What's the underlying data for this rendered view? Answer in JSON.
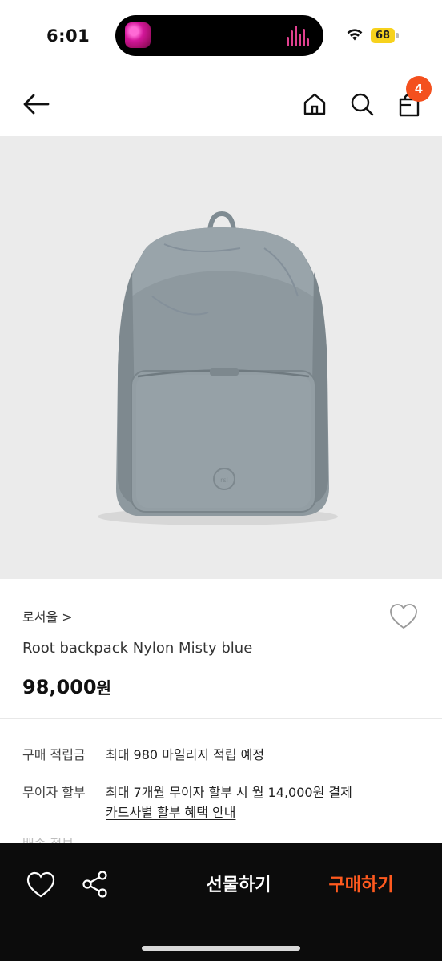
{
  "status_bar": {
    "time": "6:01",
    "battery": "68"
  },
  "nav": {
    "cart_count": "4"
  },
  "product": {
    "brand": "로서울 >",
    "name": "Root backpack Nylon Misty blue",
    "price": "98,000",
    "price_unit": "원"
  },
  "info": {
    "points_label": "구매 적립금",
    "points_value": "최대 980 마일리지 적립 예정",
    "installment_label": "무이자 할부",
    "installment_value": "최대 7개월 무이자 할부 시 월 14,000원 결제",
    "installment_link": "카드사별 할부 혜택 안내",
    "partial_label": "배송 정보"
  },
  "bottom_bar": {
    "gift_label": "선물하기",
    "buy_label": "구매하기"
  },
  "colors": {
    "accent": "#f4501e",
    "buy_text": "#ff5a1f",
    "bar_bg": "#0c0c0c",
    "product_bg": "#ebebeb"
  },
  "icons": [
    "back-arrow-icon",
    "home-icon",
    "search-icon",
    "shopping-bag-icon",
    "heart-icon",
    "share-icon"
  ]
}
